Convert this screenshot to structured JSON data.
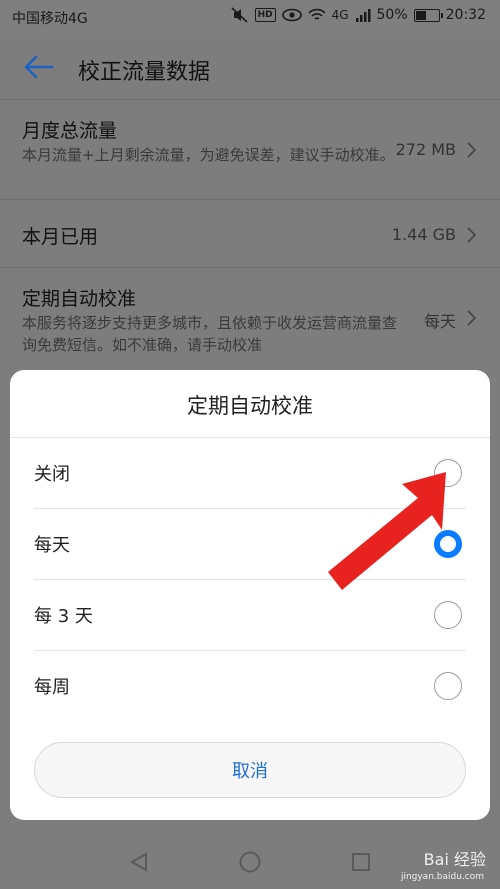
{
  "status_bar": {
    "carrier": "中国移动4G",
    "hd": "HD",
    "network": "4G",
    "battery_text": "50%",
    "battery_level": 0.5,
    "time": "20:32"
  },
  "header": {
    "title": "校正流量数据",
    "back_icon": "arrow-left-icon"
  },
  "settings": {
    "monthly_total": {
      "label": "月度总流量",
      "desc": "本月流量+上月剩余流量，为避免误差，建议手动校准。",
      "value": "272 MB"
    },
    "used_this_month": {
      "label": "本月已用",
      "value": "1.44 GB"
    },
    "auto_calibrate": {
      "label": "定期自动校准",
      "desc": "本服务将逐步支持更多城市，且依赖于收发运营商流量查询免费短信。如不准确，请手动校准",
      "value": "每天"
    }
  },
  "dialog": {
    "title": "定期自动校准",
    "options": [
      {
        "label": "关闭",
        "selected": false
      },
      {
        "label": "每天",
        "selected": true
      },
      {
        "label": "每 3 天",
        "selected": false
      },
      {
        "label": "每周",
        "selected": false
      }
    ],
    "cancel_label": "取消"
  },
  "watermark": {
    "text": "Bai 经验",
    "sub": "jingyan.baidu.com"
  },
  "colors": {
    "accent": "#0a7cff",
    "arrow": "#e8231f",
    "scrim": "#7d7d7d"
  }
}
